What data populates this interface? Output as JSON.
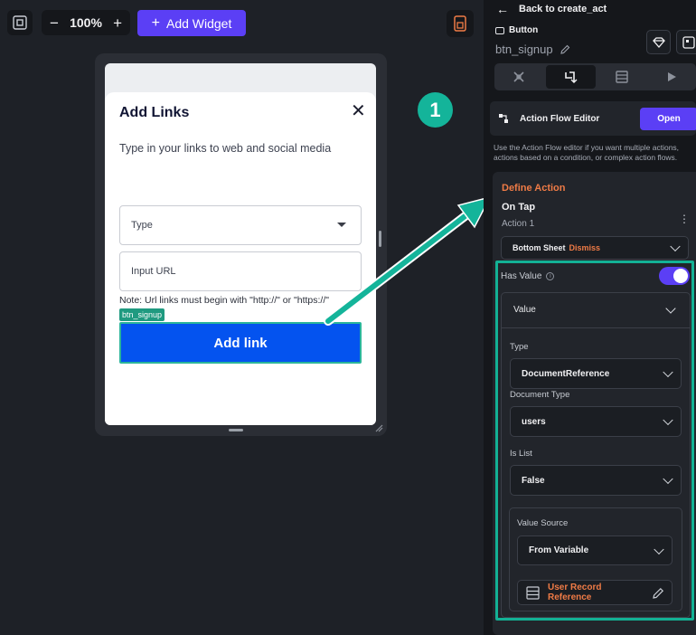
{
  "toolbar": {
    "zoom_value": "100%",
    "zoom_minus": "−",
    "zoom_plus": "+",
    "add_widget_label": "Add Widget",
    "add_widget_plus": "+",
    "accent": "#5b3ff5"
  },
  "canvas": {
    "sheet_title": "Add Links",
    "close_symbol": "✕",
    "subtitle": "Type in your links to web and social media",
    "type_placeholder": "Type",
    "url_placeholder": "Input URL",
    "note": "Note: Url links must begin with \"http://\" or \"https://\"",
    "selected_tag": "btn_signup",
    "button_label": "Add link",
    "button_color": "#0453ef"
  },
  "annotation": {
    "number": "1",
    "color": "#14b49a"
  },
  "panel": {
    "back_label": "Back to create_act",
    "back_arrow": "←",
    "component_type": "Button",
    "component_name": "btn_signup",
    "tabs": [
      "properties-icon",
      "actions-icon",
      "backend-query-icon",
      "run-icon"
    ],
    "action_flow_editor_label": "Action Flow Editor",
    "open_label": "Open",
    "help_text": "Use the Action Flow editor if you want multiple actions, actions based on a condition, or complex action flows.",
    "define_action_title": "Define Action",
    "trigger": "On Tap",
    "action_label": "Action 1",
    "kebab": "⋮",
    "action_type": "Bottom Sheet",
    "action_subtype": "Dismiss",
    "has_value_label": "Has Value",
    "has_value_on": true,
    "info_symbol": "i",
    "value_header": "Value",
    "type_label": "Type",
    "type_value": "DocumentReference",
    "doc_type_label": "Document Type",
    "doc_type_value": "users",
    "is_list_label": "Is List",
    "is_list_value": "False",
    "value_source_label": "Value Source",
    "value_source_value": "From Variable",
    "variable_value": "User Record Reference",
    "orange": "#ef7b46",
    "highlight": "#13b195"
  }
}
